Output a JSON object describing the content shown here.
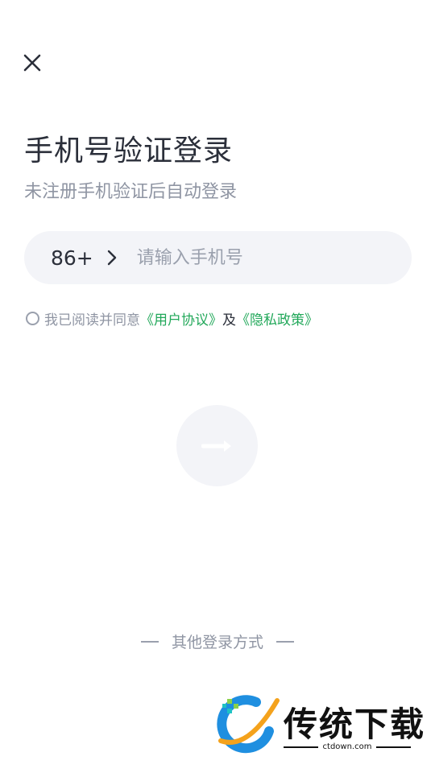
{
  "header": {
    "close_icon": "close-icon"
  },
  "title": "手机号验证登录",
  "subtitle": "未注册手机验证后自动登录",
  "phone": {
    "country_code": "86+",
    "placeholder": "请输入手机号",
    "value": ""
  },
  "agreement": {
    "prefix": "我已阅读并同意",
    "user_agreement": "《用户协议》",
    "conjunction": "及",
    "privacy_policy": "《隐私政策》",
    "checked": false
  },
  "submit": {
    "icon": "arrow-right-icon"
  },
  "other_login": {
    "label": "其他登录方式"
  },
  "watermark": {
    "text": "传统下载",
    "url": "ctdown.com"
  },
  "colors": {
    "link": "#22a85a",
    "input_bg": "#f3f4f8",
    "text": "#2b2f3a",
    "muted": "#8f95a3"
  }
}
